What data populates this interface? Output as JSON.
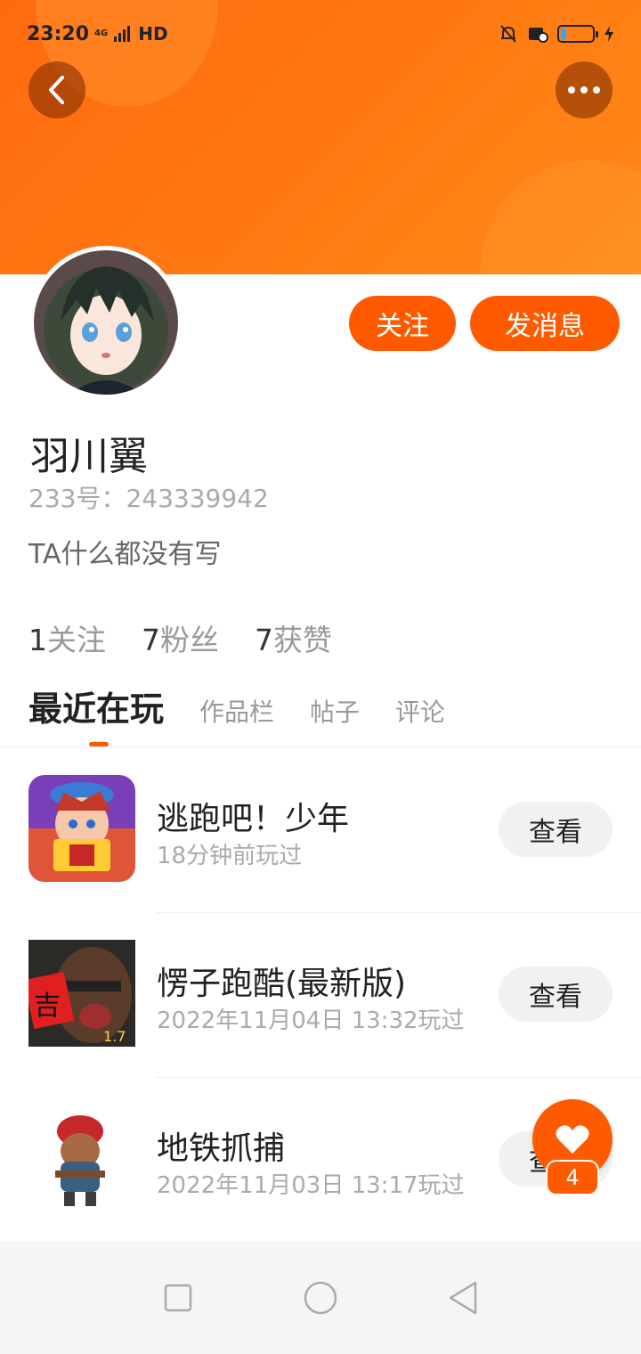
{
  "status_bar": {
    "time": "23:20",
    "network": "4G",
    "hd": "HD",
    "battery_level": 0.18
  },
  "profile": {
    "username": "羽川翼",
    "id_text": "233号：243339942",
    "bio": "TA什么都没有写",
    "follow_button": "关注",
    "message_button": "发消息"
  },
  "stats": [
    {
      "num": "1",
      "label": "关注"
    },
    {
      "num": "7",
      "label": "粉丝"
    },
    {
      "num": "7",
      "label": "获赞"
    }
  ],
  "tabs": [
    "最近在玩",
    "作品栏",
    "帖子",
    "评论"
  ],
  "games": [
    {
      "title": "逃跑吧！少年",
      "time": "18分钟前玩过",
      "button": "查看",
      "icon": "game-icon-taopao"
    },
    {
      "title": "愣子跑酷(最新版)",
      "time": "2022年11月04日 13:32玩过",
      "button": "查看",
      "icon": "game-icon-lengzi",
      "icon_badge": "1.7",
      "icon_char": "吉"
    },
    {
      "title": "地铁抓捕",
      "time": "2022年11月03日 13:17玩过",
      "button": "查看",
      "icon": "game-icon-subway"
    }
  ],
  "fab": {
    "count": "4",
    "icon": "heart-icon"
  },
  "colors": {
    "accent": "#ff5a00",
    "banner": "#ff7a12"
  }
}
